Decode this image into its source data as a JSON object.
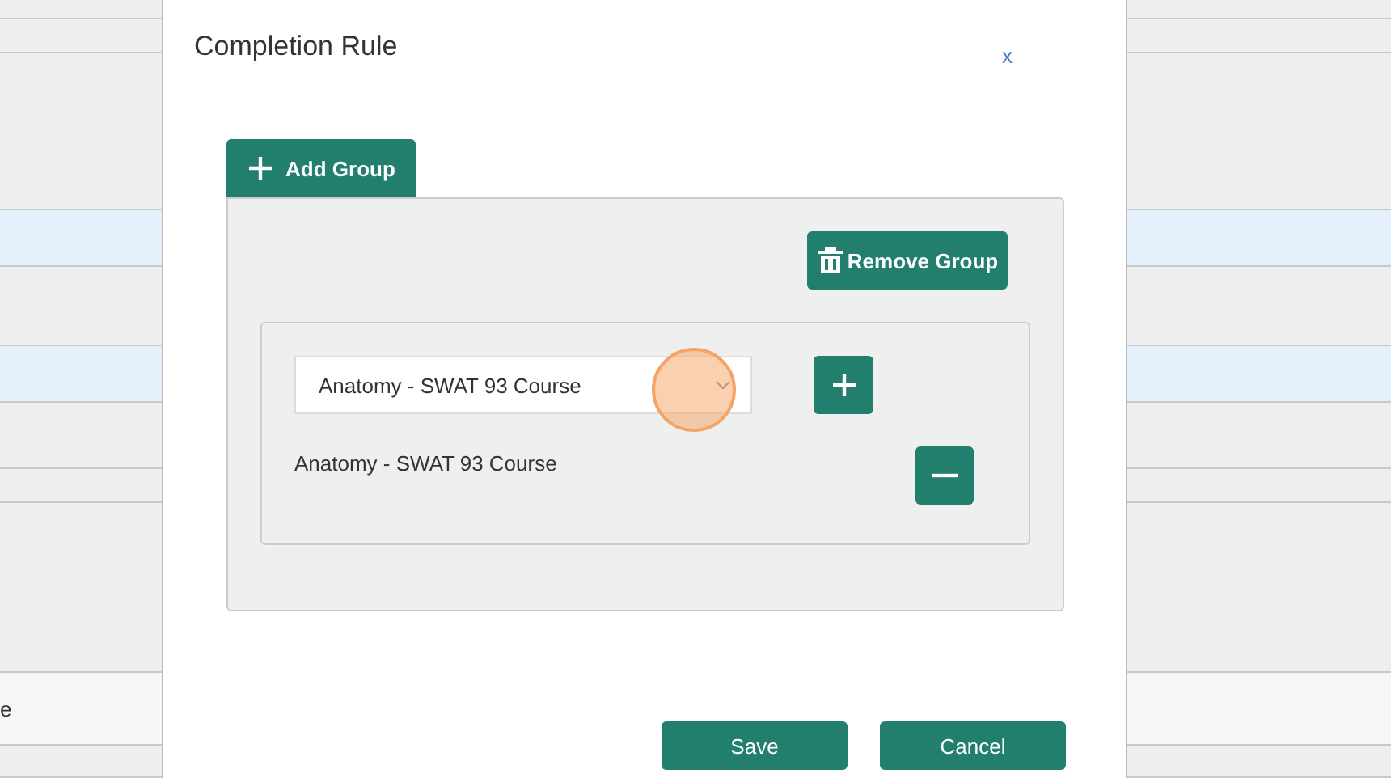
{
  "background": {
    "row_text": "e"
  },
  "dialog": {
    "title": "Completion Rule",
    "close": "x",
    "add_group": "Add Group",
    "groups": [
      {
        "remove_label": "Remove Group",
        "rules": [
          {
            "select_value": "Anatomy - SWAT 93 Course",
            "item": "Anatomy - SWAT 93 Course"
          }
        ]
      }
    ],
    "buttons": [
      "Save",
      "Cancel"
    ]
  }
}
